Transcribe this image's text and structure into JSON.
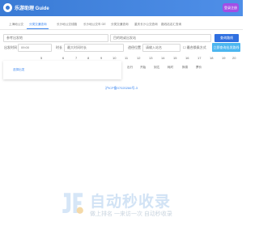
{
  "header": {
    "brand": "乐游助理 Guide",
    "action_label": "登录注册"
  },
  "tabs": [
    {
      "label": "上海地公交"
    },
    {
      "label": "分类交通查询"
    },
    {
      "label": "长沙地公交线路"
    },
    {
      "label": "长沙地公交车 GE"
    },
    {
      "label": "分类交通查询"
    },
    {
      "label": "重庆长沙公交查询"
    },
    {
      "label": "路线站名汇查询"
    }
  ],
  "form": {
    "start_value": "参考出发地",
    "destination_value": "目的地或出发站",
    "search_label": "查询路线",
    "time_label": "出发时间",
    "time_value": "09:00",
    "duration_label": "时长",
    "duration_placeholder": "最大时间时长",
    "stop_label": "途径位置",
    "stop_placeholder": "请输入站名",
    "transfer_label": "最合换乘方式",
    "reset_label": "立即查询出发路线"
  },
  "hours": [
    "5",
    "6",
    "7",
    "8",
    "9",
    "10",
    "11",
    "12",
    "13",
    "14",
    "15",
    "16",
    "17",
    "18",
    "19",
    "20",
    "21"
  ],
  "dropdown": {
    "item": "选择出发"
  },
  "columns": [
    "出行",
    "开始",
    "到达",
    "耗时",
    "换乘",
    "票价"
  ],
  "footer": {
    "icp": "沪ICP备07020266号-3"
  },
  "watermark": {
    "title": "自动秒收录",
    "subtitle": "做上排名 一来访一次 自动秒收录"
  }
}
